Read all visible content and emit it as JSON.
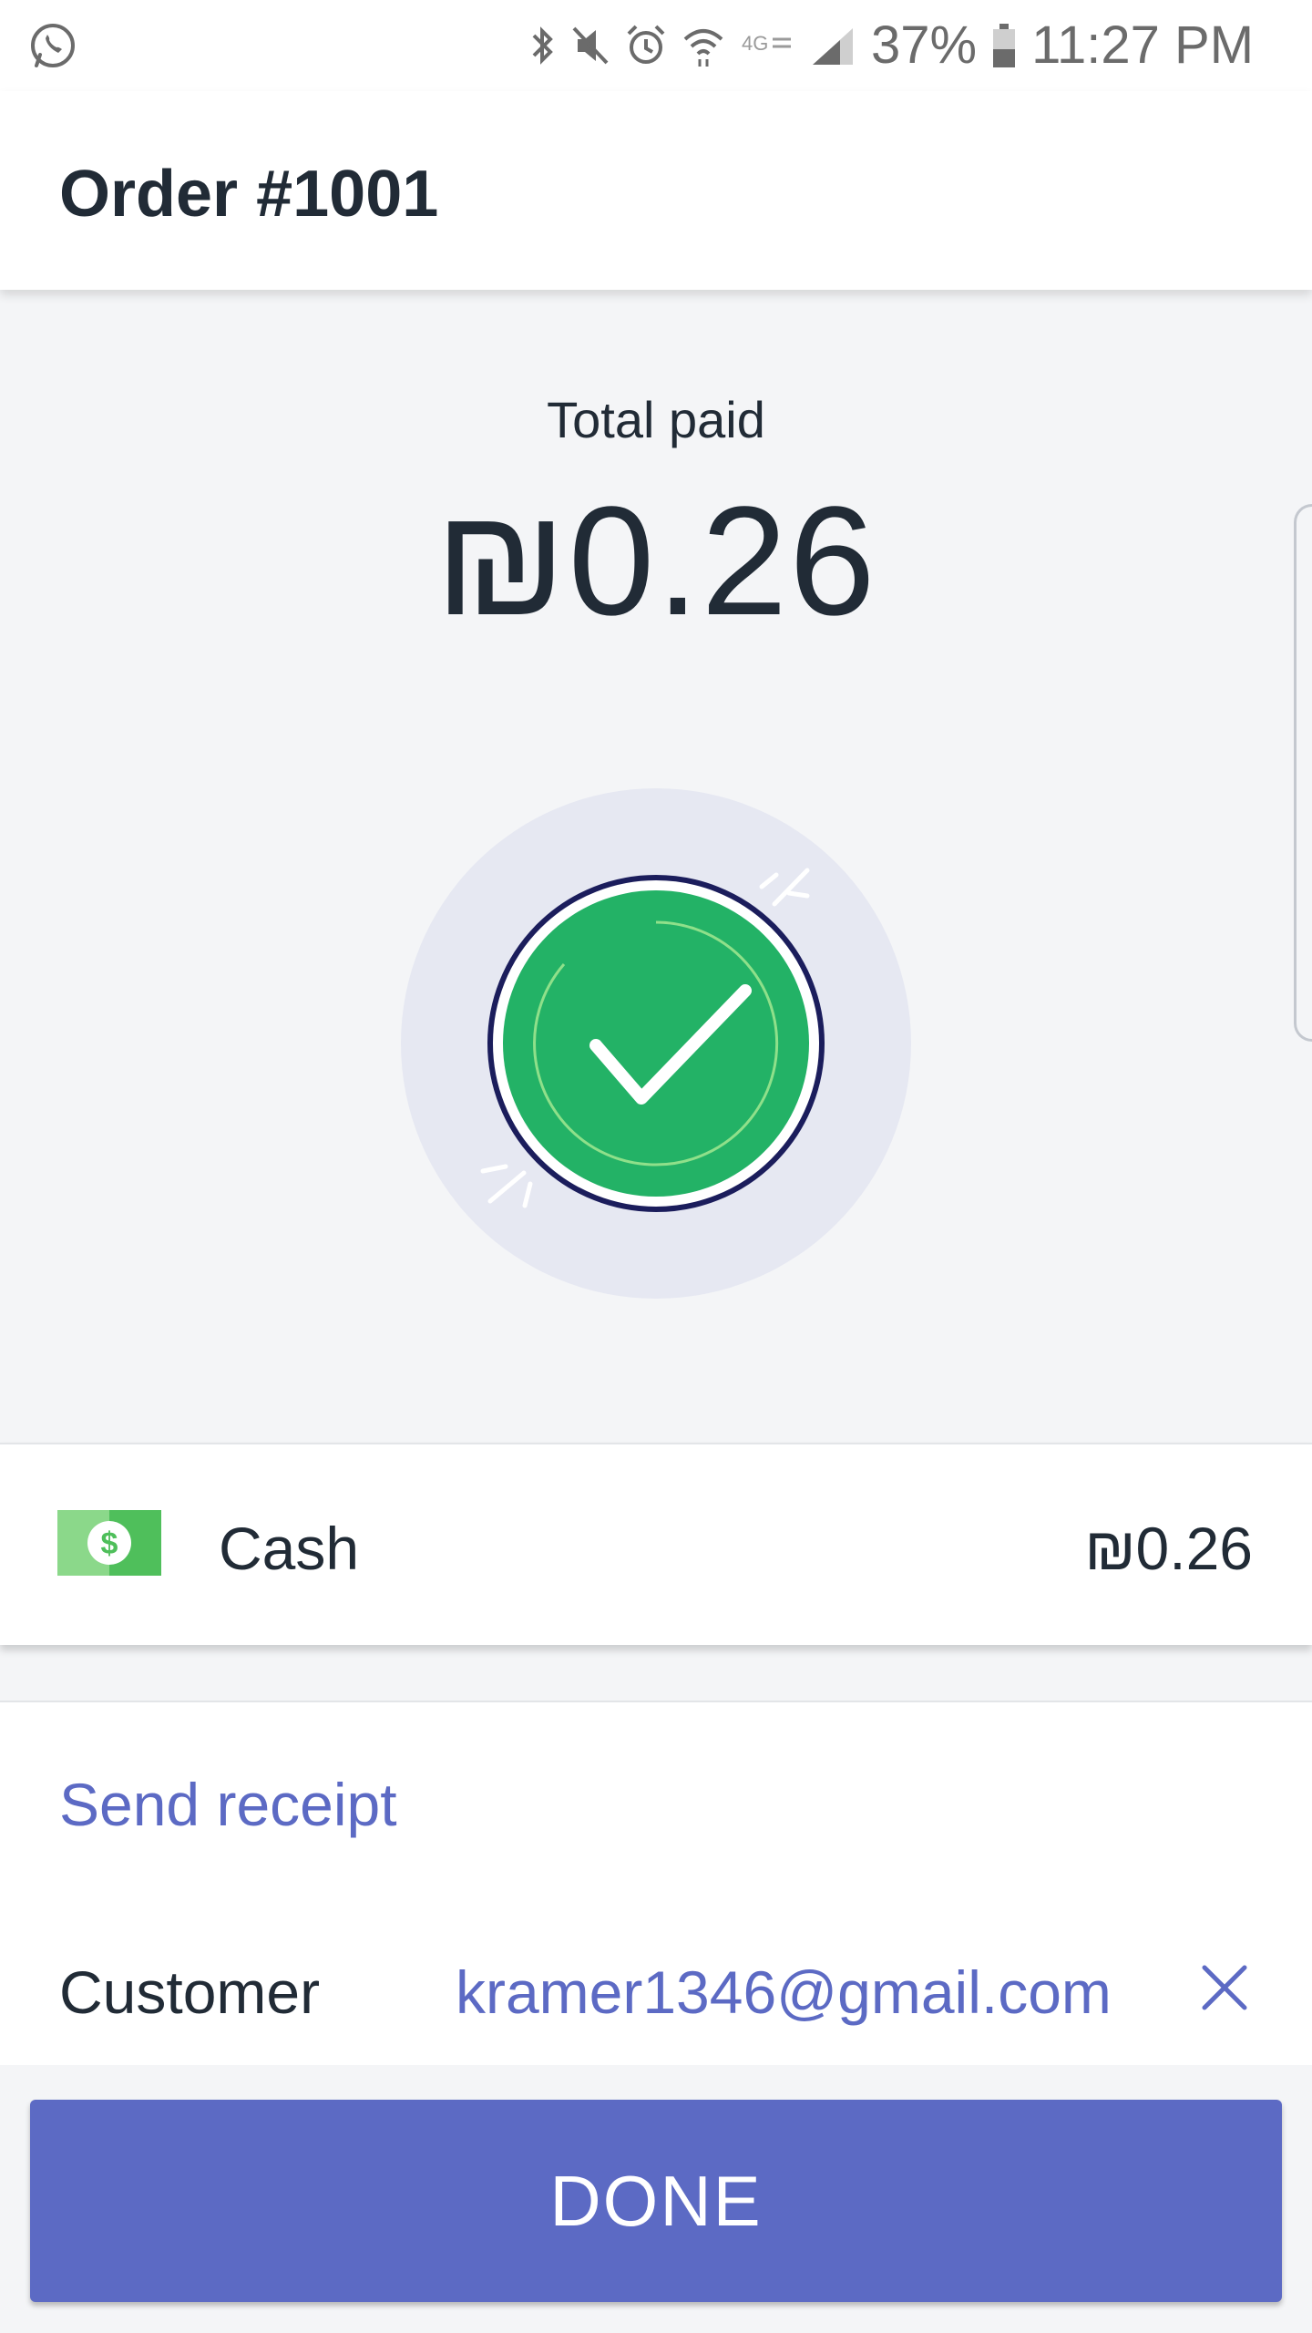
{
  "status_bar": {
    "battery": "37%",
    "time": "11:27 PM",
    "icons": [
      "whatsapp-icon",
      "bluetooth-icon",
      "mute-icon",
      "alarm-icon",
      "wifi-icon",
      "4g-icon",
      "signal-icon",
      "battery-icon"
    ]
  },
  "header": {
    "title": "Order #1001"
  },
  "summary": {
    "total_label": "Total paid",
    "total_amount": "₪0.26"
  },
  "payment": {
    "method": "Cash",
    "amount": "₪0.26",
    "icon": "cash-icon"
  },
  "receipt": {
    "send_label": "Send receipt",
    "customer_label": "Customer",
    "customer_email": "kramer1346@gmail.com"
  },
  "footer": {
    "done_label": "DONE"
  },
  "colors": {
    "accent": "#5c6ac4",
    "success": "#23b266",
    "text": "#212b36",
    "background": "#f4f5f7"
  }
}
